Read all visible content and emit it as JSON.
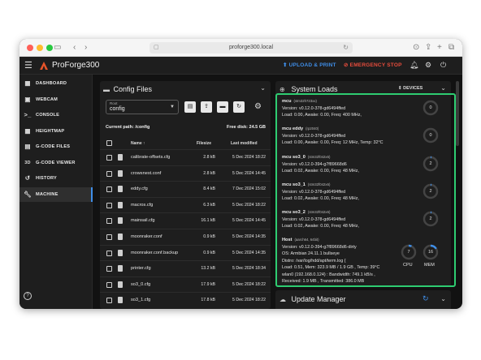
{
  "browser": {
    "url": "proforge300.local",
    "back_icon": "chevron-left-icon",
    "forward_icon": "chevron-right-icon"
  },
  "app": {
    "title": "ProForge300",
    "upload_print": "UPLOAD & PRINT",
    "emergency_stop": "EMERGENCY STOP",
    "accent_color": "#3f8ee8",
    "estop_color": "#e74c3c",
    "highlight_color": "#2ecc71"
  },
  "sidebar": {
    "items": [
      {
        "label": "DASHBOARD",
        "icon": "dashboard-icon"
      },
      {
        "label": "WEBCAM",
        "icon": "webcam-icon"
      },
      {
        "label": "CONSOLE",
        "icon": "console-icon"
      },
      {
        "label": "HEIGHTMAP",
        "icon": "grid-icon"
      },
      {
        "label": "G-CODE FILES",
        "icon": "files-icon"
      },
      {
        "label": "G-CODE VIEWER",
        "icon": "3d-icon"
      },
      {
        "label": "HISTORY",
        "icon": "history-icon"
      },
      {
        "label": "MACHINE",
        "icon": "wrench-icon",
        "active": true
      }
    ]
  },
  "config": {
    "title": "Config Files",
    "root_label": "Root",
    "root_value": "config",
    "current_path": "Current path: /config",
    "free_disk": "Free disk: 24.5 GB",
    "columns": {
      "name": "Name",
      "size": "Filesize",
      "modified": "Last modified"
    },
    "files": [
      {
        "name": "calibrate-offsets.cfg",
        "size": "2.8 kB",
        "modified": "5 Dec 2024 18:22"
      },
      {
        "name": "crowsnest.conf",
        "size": "2.8 kB",
        "modified": "5 Dec 2024 14:45"
      },
      {
        "name": "eddy.cfg",
        "size": "8.4 kB",
        "modified": "7 Dec 2024 15:02"
      },
      {
        "name": "macros.cfg",
        "size": "6.3 kB",
        "modified": "5 Dec 2024 18:22"
      },
      {
        "name": "mainsail.cfg",
        "size": "16.1 kB",
        "modified": "5 Dec 2024 14:45"
      },
      {
        "name": "moonraker.conf",
        "size": "0.9 kB",
        "modified": "5 Dec 2024 14:35"
      },
      {
        "name": "moonraker.conf.backup",
        "size": "0.9 kB",
        "modified": "5 Dec 2024 14:35"
      },
      {
        "name": "printer.cfg",
        "size": "13.2 kB",
        "modified": "5 Dec 2024 18:34"
      },
      {
        "name": "so3_0.cfg",
        "size": "17.9 kB",
        "modified": "5 Dec 2024 18:22"
      },
      {
        "name": "so3_1.cfg",
        "size": "17.8 kB",
        "modified": "5 Dec 2024 18:22"
      }
    ]
  },
  "loads": {
    "title": "System Loads",
    "devices": "DEVICES",
    "mcus": [
      {
        "name": "mcu",
        "chip": "(stm32h723xx)",
        "lines": [
          "Version: v0.12.0-378-gd6494ffed",
          "Load: 0.00, Awake: 0.00, Freq: 400 MHz,"
        ],
        "gauge": "0",
        "pct": 0
      },
      {
        "name": "mcu eddy",
        "chip": "(rp2040)",
        "lines": [
          "Version: v0.12.0-378-gd6494ffed",
          "Load: 0.00, Awake: 0.00, Freq: 12 MHz, Temp: 32°C"
        ],
        "gauge": "0",
        "pct": 0
      },
      {
        "name": "mcu so3_0",
        "chip": "(stm32f042x6)",
        "lines": [
          "Version: v0.12.0-394-g7f89668d6",
          "Load: 0.02, Awake: 0.00, Freq: 48 MHz,"
        ],
        "gauge": "2",
        "pct": 2
      },
      {
        "name": "mcu so3_1",
        "chip": "(stm32f042x6)",
        "lines": [
          "Version: v0.12.0-378-gd6494ffed",
          "Load: 0.02, Awake: 0.00, Freq: 48 MHz,"
        ],
        "gauge": "2",
        "pct": 2
      },
      {
        "name": "mcu so3_2",
        "chip": "(stm32f042x6)",
        "lines": [
          "Version: v0.12.0-378-gd6494ffed",
          "Load: 0.02, Awake: 0.00, Freq: 48 MHz,"
        ],
        "gauge": "2",
        "pct": 2
      }
    ],
    "host": {
      "name": "Host",
      "chip": "(aarch64, 64bit)",
      "lines": [
        "Version: v0.12.0-394-g7f89668d6-dirty",
        "OS: Armbian 24.11.1 bullseye",
        "Distro: /var/log/hdd/apt/term.log {",
        "Load: 0.51, Mem: 323.9 MB / 1.9 GB , Temp: 39°C",
        "wlan0 (192.168.0.124) : Bandwidth: 749.1 kB/s ,",
        "Received: 1.9 MB , Transmitted: 386.0 MB"
      ],
      "cpu_value": "7",
      "cpu_pct": 7,
      "cpu_label": "CPU",
      "mem_value": "16",
      "mem_pct": 16,
      "mem_label": "MEM"
    }
  },
  "update": {
    "title": "Update Manager"
  }
}
